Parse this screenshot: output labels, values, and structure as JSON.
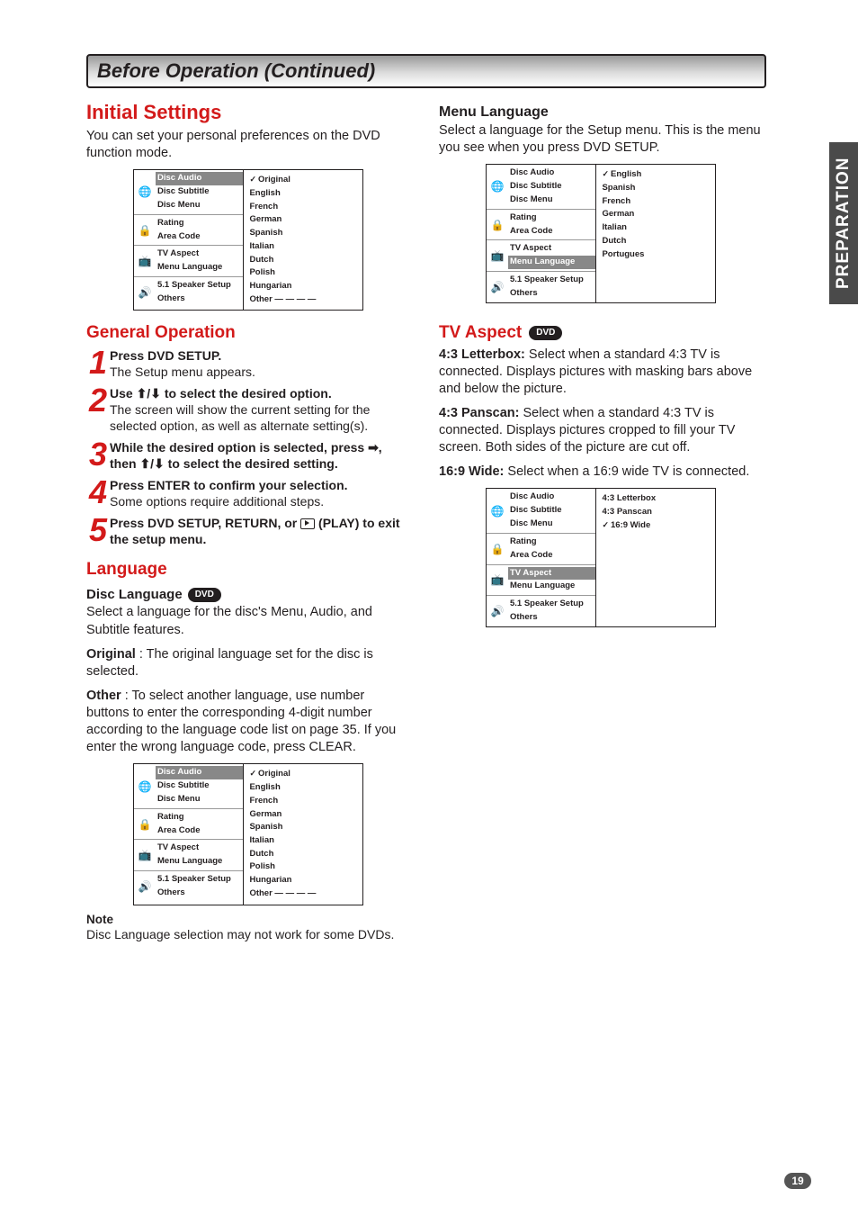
{
  "sideTab": "PREPARATION",
  "titleBar": "Before Operation (Continued)",
  "pageNumber": "19",
  "left": {
    "h_initial": "Initial Settings",
    "p_initial": "You can set your personal preferences on the DVD function mode.",
    "h_general": "General Operation",
    "steps": [
      {
        "bold": "Press DVD SETUP.",
        "rest": "The Setup menu appears."
      },
      {
        "bold": "Use ⬆/⬇ to select the desired option.",
        "rest": "The screen will show the current setting for the selected option, as well as alternate setting(s)."
      },
      {
        "bold": "While the desired option is selected, press ➡, then ⬆/⬇ to select the desired setting.",
        "rest": ""
      },
      {
        "bold": "Press ENTER to confirm your selection.",
        "rest": "Some options require additional steps."
      },
      {
        "bold": "Press DVD SETUP, RETURN, or",
        "bold2": "(PLAY) to exit the setup menu.",
        "rest": ""
      }
    ],
    "h_language": "Language",
    "h_disc_lang": "Disc Language",
    "p_disc_lang1": "Select a language for the disc's Menu, Audio, and Subtitle features.",
    "p_original_b": "Original",
    "p_original": " : The original language set for the disc is selected.",
    "p_other_b": "Other",
    "p_other": " : To select another language, use number buttons to enter the corresponding 4-digit number according to the language code list on page 35. If you enter the wrong language code, press CLEAR.",
    "note_h": "Note",
    "note_b": "Disc Language selection may not work for some DVDs."
  },
  "right": {
    "h_menu_lang": "Menu Language",
    "p_menu_lang": "Select a language for the Setup menu. This is the menu you see when you press DVD SETUP.",
    "h_tv_aspect": "TV Aspect",
    "p_43lb_b": "4:3 Letterbox:",
    "p_43lb": " Select when a standard 4:3 TV is connected. Displays pictures with masking bars above and below the picture.",
    "p_43ps_b": "4:3 Panscan:",
    "p_43ps": " Select when a standard 4:3 TV is connected. Displays pictures cropped to fill your TV screen. Both sides of the picture are cut off.",
    "p_169_b": "16:9 Wide:",
    "p_169": " Select when a 16:9 wide TV is connected."
  },
  "menuGroups": [
    {
      "icon": "🌐",
      "items": [
        "Disc Audio",
        "Disc Subtitle",
        "Disc Menu"
      ]
    },
    {
      "icon": "🔒",
      "items": [
        "Rating",
        "Area Code"
      ]
    },
    {
      "icon": "📺",
      "items": [
        "TV Aspect",
        "Menu Language"
      ]
    },
    {
      "icon": "🔊",
      "items": [
        "5.1 Speaker Setup",
        "Others"
      ]
    }
  ],
  "shot1": {
    "highlight": "Disc Audio",
    "options": [
      "Original",
      "English",
      "French",
      "German",
      "Spanish",
      "Italian",
      "Dutch",
      "Polish",
      "Hungarian",
      "Other  — — — —"
    ],
    "selected": "Original"
  },
  "shot2": {
    "highlight": "Disc Audio",
    "options": [
      "Original",
      "English",
      "French",
      "German",
      "Spanish",
      "Italian",
      "Dutch",
      "Polish",
      "Hungarian",
      "Other  — — — —"
    ],
    "selected": "Original"
  },
  "shot3": {
    "highlight": "Menu Language",
    "options": [
      "English",
      "Spanish",
      "French",
      "German",
      "Italian",
      "Dutch",
      "Portugues"
    ],
    "selected": "English"
  },
  "shot4": {
    "highlight": "TV Aspect",
    "options": [
      "4:3   Letterbox",
      "4:3   Panscan",
      "16:9 Wide"
    ],
    "selected": "16:9 Wide"
  }
}
